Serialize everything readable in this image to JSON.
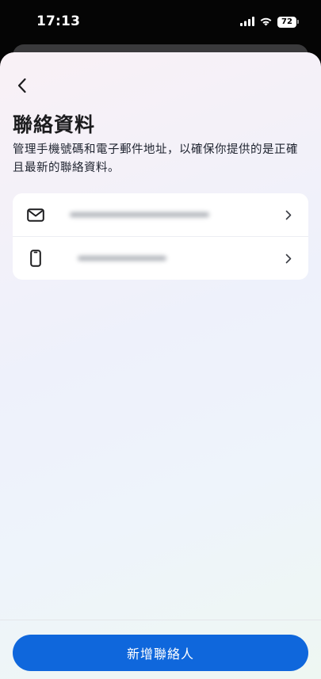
{
  "status_bar": {
    "time": "17:13",
    "battery": "72"
  },
  "header": {
    "title": "聯絡資料",
    "description": "管理手機號碼和電子郵件地址，以確保你提供的是正確且最新的聯絡資料。"
  },
  "contacts": [
    {
      "type": "email",
      "icon": "mail-icon"
    },
    {
      "type": "phone",
      "icon": "phone-icon"
    }
  ],
  "footer": {
    "add_button_label": "新增聯絡人"
  },
  "colors": {
    "primary": "#0f67dc",
    "title_text": "#1c1c1e"
  }
}
